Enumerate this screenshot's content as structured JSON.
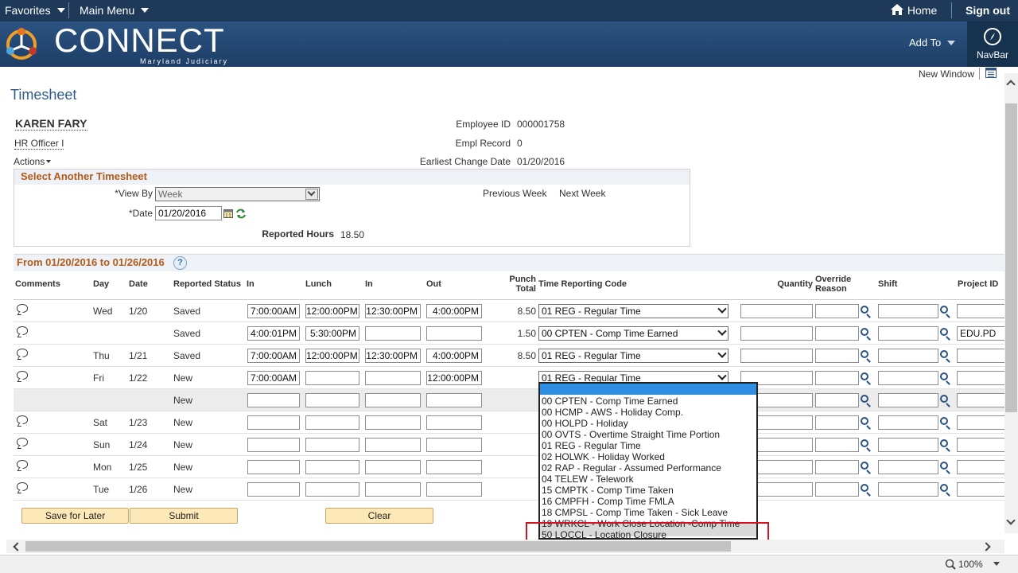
{
  "topbar": {
    "favorites": "Favorites",
    "main_menu": "Main Menu",
    "home": "Home",
    "sign_out": "Sign out"
  },
  "banner": {
    "logo": "CONNECT",
    "logo_sub": "Maryland Judiciary",
    "add_to": "Add To",
    "navbar": "NavBar"
  },
  "page": {
    "title": "Timesheet",
    "new_window": "New Window"
  },
  "employee": {
    "name": "KAREN FARY",
    "job_title": "HR Officer I",
    "actions": "Actions",
    "id_label": "Employee ID",
    "id_value": "000001758",
    "empl_record_label": "Empl Record",
    "empl_record_value": "0",
    "earliest_label": "Earliest Change Date",
    "earliest_value": "01/20/2016"
  },
  "select_timesheet": {
    "header": "Select Another Timesheet",
    "view_by_label": "*View By",
    "view_by_value": "Week",
    "date_label": "*Date",
    "date_value": "01/20/2016",
    "previous_week": "Previous Week",
    "next_week": "Next Week",
    "reported_hours_label": "Reported Hours",
    "reported_hours_value": "18.50"
  },
  "grid": {
    "period": "From 01/20/2016 to 01/26/2016",
    "headers": {
      "comments": "Comments",
      "day": "Day",
      "date": "Date",
      "status": "Reported Status",
      "in1": "In",
      "lunch": "Lunch",
      "in2": "In",
      "out": "Out",
      "punch_total_1": "Punch",
      "punch_total_2": "Total",
      "trc": "Time Reporting Code",
      "quantity": "Quantity",
      "override_1": "Override",
      "override_2": "Reason",
      "shift": "Shift",
      "project_id": "Project ID"
    },
    "rows": [
      {
        "day": "Wed",
        "date": "1/20",
        "status": "Saved",
        "in1": "7:00:00AM",
        "lunch": "12:00:00PM",
        "in2": "12:30:00PM",
        "out": "4:00:00PM",
        "total": "8.50",
        "trc": "01 REG - Regular Time",
        "project": ""
      },
      {
        "day": "",
        "date": "",
        "status": "Saved",
        "in1": "4:00:01PM",
        "lunch": "5:30:00PM",
        "in2": "",
        "out": "",
        "total": "1.50",
        "trc": "00 CPTEN - Comp Time Earned",
        "project": "EDU.PD"
      },
      {
        "day": "Thu",
        "date": "1/21",
        "status": "Saved",
        "in1": "7:00:00AM",
        "lunch": "12:00:00PM",
        "in2": "12:30:00PM",
        "out": "4:00:00PM",
        "total": "8.50",
        "trc": "01 REG - Regular Time",
        "project": ""
      },
      {
        "day": "Fri",
        "date": "1/22",
        "status": "New",
        "in1": "7:00:00AM",
        "lunch": "",
        "in2": "",
        "out": "12:00:00PM",
        "total": "",
        "trc": "01 REG - Regular Time",
        "project": ""
      },
      {
        "day": "",
        "date": "",
        "status": "New",
        "in1": "",
        "lunch": "",
        "in2": "",
        "out": "",
        "total": "",
        "trc": "",
        "project": ""
      },
      {
        "day": "Sat",
        "date": "1/23",
        "status": "New",
        "in1": "",
        "lunch": "",
        "in2": "",
        "out": "",
        "total": "",
        "trc": "",
        "project": ""
      },
      {
        "day": "Sun",
        "date": "1/24",
        "status": "New",
        "in1": "",
        "lunch": "",
        "in2": "",
        "out": "",
        "total": "",
        "trc": "",
        "project": ""
      },
      {
        "day": "Mon",
        "date": "1/25",
        "status": "New",
        "in1": "",
        "lunch": "",
        "in2": "",
        "out": "",
        "total": "",
        "trc": "",
        "project": ""
      },
      {
        "day": "Tue",
        "date": "1/26",
        "status": "New",
        "in1": "",
        "lunch": "",
        "in2": "",
        "out": "",
        "total": "",
        "trc": "",
        "project": ""
      }
    ]
  },
  "dropdown_options": [
    "00 CPTEN - Comp Time Earned",
    "00 HCMP - AWS - Holiday Comp.",
    "00 HOLPD - Holiday",
    "00 OVTS - Overtime Straight Time Portion",
    "01 REG - Regular Time",
    "02 HOLWK - Holiday Worked",
    "02 RAP - Regular - Assumed Performance",
    "04 TELEW - Telework",
    "15 CMPTK - Comp Time Taken",
    "16 CMPFH - Comp Time FMLA",
    "18 CMPSL - Comp Time Taken - Sick Leave",
    "19 WRKCL - Work Close Location -Comp Time",
    "50 LOCCL - Location Closure"
  ],
  "buttons": {
    "save": "Save for Later",
    "submit": "Submit",
    "clear": "Clear"
  },
  "status": {
    "zoom": "100%"
  }
}
